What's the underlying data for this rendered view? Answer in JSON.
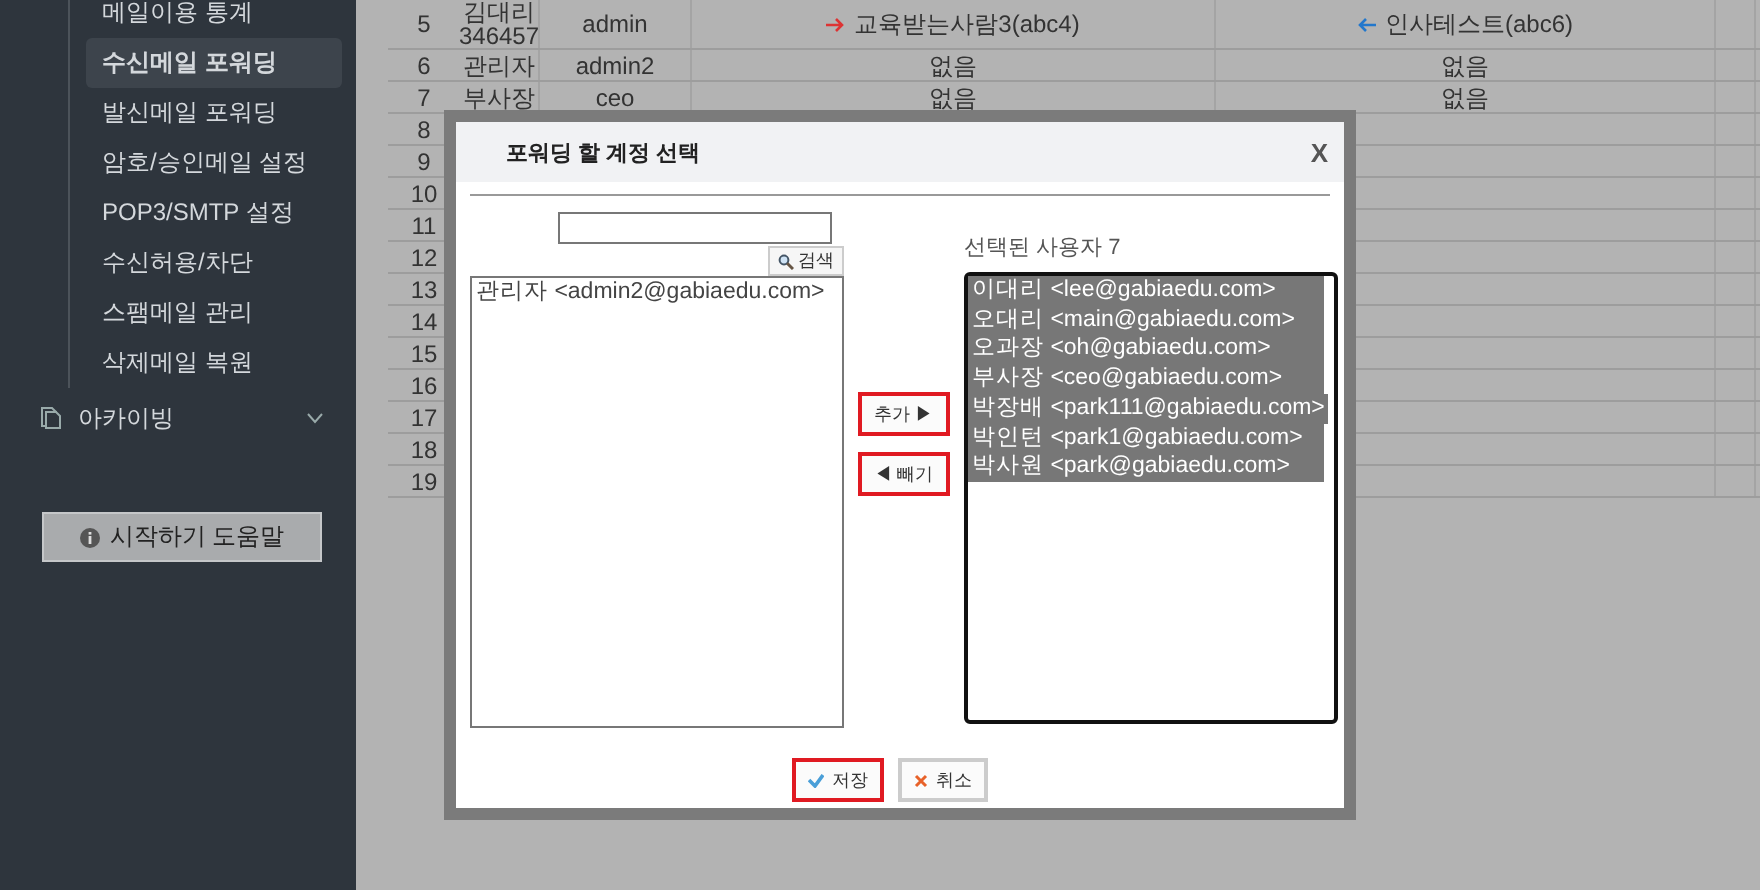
{
  "sidebar": {
    "items": [
      {
        "label": "메일이용 통계",
        "selected": false
      },
      {
        "label": "수신메일 포워딩",
        "selected": true
      },
      {
        "label": "발신메일 포워딩",
        "selected": false
      },
      {
        "label": "암호/승인메일 설정",
        "selected": false
      },
      {
        "label": "POP3/SMTP 설정",
        "selected": false
      },
      {
        "label": "수신허용/차단",
        "selected": false
      },
      {
        "label": "스팸메일 관리",
        "selected": false
      },
      {
        "label": "삭제메일 복원",
        "selected": false
      }
    ],
    "section": {
      "label": "아카이빙",
      "expanded": false
    },
    "help_button": "시작하기 도움말"
  },
  "table": {
    "rows": [
      {
        "number": "5",
        "name": "김대리\n346457",
        "user_id": "admin",
        "forward_to": "교육받는사람3(abc4)",
        "forward_from": "인사테스트(abc6)"
      },
      {
        "number": "6",
        "name": "관리자",
        "user_id": "admin2",
        "forward_to": "없음",
        "forward_from": "없음"
      },
      {
        "number": "7",
        "name": "부사장",
        "user_id": "ceo",
        "forward_to": "없음",
        "forward_from": "없음"
      },
      {
        "number": "8"
      },
      {
        "number": "9"
      },
      {
        "number": "10"
      },
      {
        "number": "11"
      },
      {
        "number": "12"
      },
      {
        "number": "13"
      },
      {
        "number": "14"
      },
      {
        "number": "15"
      },
      {
        "number": "16"
      },
      {
        "number": "17"
      },
      {
        "number": "18"
      },
      {
        "number": "19"
      }
    ]
  },
  "dialog": {
    "title": "포워딩 할 계정 선택",
    "close": "X",
    "search_button": "검색",
    "selected_heading": "선택된 사용자 7",
    "available_users": [
      {
        "label": "관리자 <admin2@gabiaedu.com>",
        "selected": false
      }
    ],
    "selected_users": [
      {
        "label": "이대리 <lee@gabiaedu.com>",
        "selected": true
      },
      {
        "label": "오대리 <main@gabiaedu.com>",
        "selected": true
      },
      {
        "label": "오과장 <oh@gabiaedu.com>",
        "selected": true
      },
      {
        "label": "부사장 <ceo@gabiaedu.com>",
        "selected": true
      },
      {
        "label": "박장배 <park111@gabiaedu.com>",
        "selected": true
      },
      {
        "label": "박인턴 <park1@gabiaedu.com>",
        "selected": true
      },
      {
        "label": "박사원 <park@gabiaedu.com>",
        "selected": true
      }
    ],
    "add_button": {
      "label": "추가 ▶",
      "highlighted": true
    },
    "remove_button": {
      "label": "◀ 빼기",
      "highlighted": true
    },
    "save_button": {
      "label": "저장",
      "highlighted": true
    },
    "cancel_button": {
      "label": "취소",
      "highlighted": false
    }
  }
}
